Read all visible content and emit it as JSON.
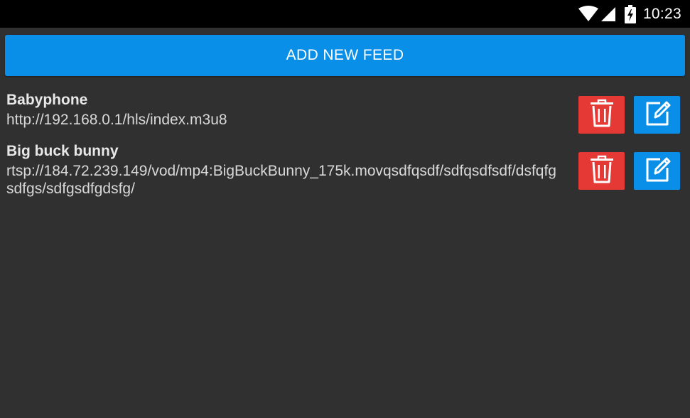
{
  "status_bar": {
    "time": "10:23",
    "icons": [
      "wifi-icon",
      "cell-signal-icon",
      "battery-charging-icon"
    ]
  },
  "add_button": {
    "label": "ADD NEW FEED"
  },
  "feeds": [
    {
      "name": "Babyphone",
      "url": "http://192.168.0.1/hls/index.m3u8"
    },
    {
      "name": "Big buck bunny",
      "url": "rtsp://184.72.239.149/vod/mp4:BigBuckBunny_175k.movqsdfqsdf/sdfqsdfsdf/dsfqfgsdfgs/sdfgsdfgdsfg/"
    }
  ],
  "colors": {
    "background": "#303030",
    "accent": "#0a8fe8",
    "delete": "#e53935"
  }
}
